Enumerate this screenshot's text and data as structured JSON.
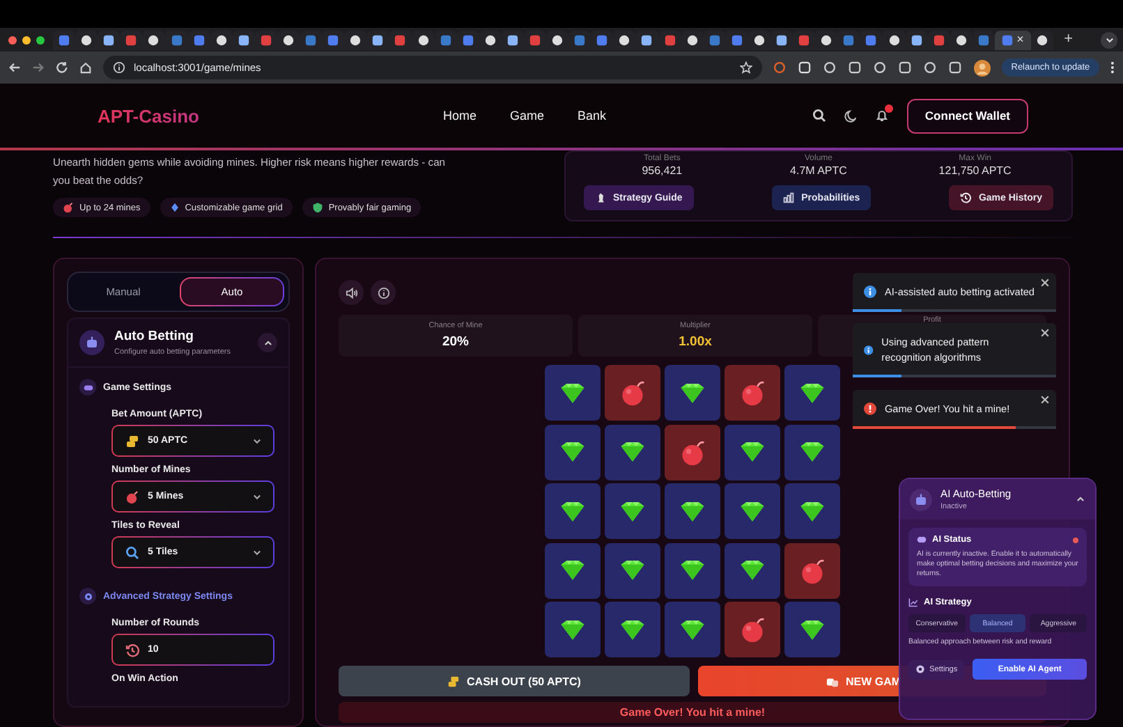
{
  "browser": {
    "tabs": [
      {
        "selected": false
      },
      {
        "selected": false
      },
      {
        "selected": false
      },
      {
        "selected": false
      },
      {
        "selected": false
      },
      {
        "selected": false
      },
      {
        "selected": false
      },
      {
        "selected": false
      },
      {
        "selected": false
      },
      {
        "selected": false
      },
      {
        "selected": false
      },
      {
        "selected": false
      },
      {
        "selected": false
      },
      {
        "selected": false
      },
      {
        "selected": false
      },
      {
        "selected": false
      },
      {
        "selected": false
      },
      {
        "selected": false
      },
      {
        "selected": false
      },
      {
        "selected": false
      },
      {
        "selected": false
      },
      {
        "selected": false
      },
      {
        "selected": false
      },
      {
        "selected": false
      },
      {
        "selected": false
      },
      {
        "selected": false
      },
      {
        "selected": false
      },
      {
        "selected": false
      },
      {
        "selected": false
      },
      {
        "selected": false
      },
      {
        "selected": false
      },
      {
        "selected": false
      },
      {
        "selected": false
      },
      {
        "selected": false
      },
      {
        "selected": false
      },
      {
        "selected": false
      },
      {
        "selected": false
      },
      {
        "selected": false
      },
      {
        "selected": false
      },
      {
        "selected": false
      },
      {
        "selected": false
      },
      {
        "selected": false
      },
      {
        "selected": true,
        "close": "×"
      },
      {
        "selected": false
      }
    ],
    "new_tab": "+",
    "url": "localhost:3001/game/mines",
    "update_button": "Relaunch to update"
  },
  "header": {
    "logo": "APT-Casino",
    "nav": [
      "Home",
      "Game",
      "Bank"
    ],
    "connect_button": "Connect Wallet"
  },
  "hero": {
    "description": "Unearth hidden gems while avoiding mines. Higher risk means higher rewards - can you beat the odds?",
    "features": [
      {
        "kind": "mine",
        "label": "Up to 24 mines"
      },
      {
        "kind": "grid",
        "label": "Customizable game grid"
      },
      {
        "kind": "fair",
        "label": "Provably fair gaming"
      }
    ]
  },
  "stats": [
    {
      "label": "Total Bets",
      "value": "956,421"
    },
    {
      "label": "Volume",
      "value": "4.7M APTC"
    },
    {
      "label": "Max Win",
      "value": "121,750 APTC"
    }
  ],
  "action_buttons": [
    {
      "kind": "guide",
      "label": "Strategy Guide",
      "color": "#35184f"
    },
    {
      "kind": "chart",
      "label": "Probabilities",
      "color": "#1d2350"
    },
    {
      "kind": "history",
      "label": "Game History",
      "color": "#461427"
    }
  ],
  "mode_toggle": [
    {
      "label": "Manual",
      "selected": false
    },
    {
      "label": "Auto",
      "selected": true
    }
  ],
  "auto_betting": {
    "title": "Auto Betting",
    "subtitle": "Configure auto betting parameters",
    "expanded": true,
    "sections": [
      {
        "kind": "game",
        "title": "Game Settings",
        "fields": [
          {
            "label": "Bet Amount (APTC)",
            "kind": "select",
            "value": "50 APTC"
          },
          {
            "label": "Number of Mines",
            "kind": "select",
            "value": "5 Mines"
          },
          {
            "label": "Tiles to Reveal",
            "kind": "select",
            "value": "5 Tiles"
          }
        ]
      },
      {
        "kind": "advanced",
        "title": "Advanced Strategy Settings",
        "fields": [
          {
            "label": "Number of Rounds",
            "kind": "input",
            "value": "10"
          },
          {
            "label": "On Win Action"
          }
        ]
      }
    ]
  },
  "game": {
    "stats": [
      {
        "label": "Chance of Mine",
        "value": "20%",
        "kind": "plain"
      },
      {
        "label": "Multiplier",
        "value": "1.00x",
        "kind": "highlight"
      },
      {
        "label": "Profit"
      }
    ],
    "tiles": [
      {
        "kind": "gem"
      },
      {
        "kind": "mine"
      },
      {
        "kind": "gem"
      },
      {
        "kind": "mine"
      },
      {
        "kind": "gem"
      },
      {
        "kind": "gem"
      },
      {
        "kind": "gem"
      },
      {
        "kind": "mine"
      },
      {
        "kind": "gem"
      },
      {
        "kind": "gem"
      },
      {
        "kind": "gem"
      },
      {
        "kind": "gem"
      },
      {
        "kind": "gem"
      },
      {
        "kind": "gem"
      },
      {
        "kind": "gem"
      },
      {
        "kind": "gem"
      },
      {
        "kind": "gem"
      },
      {
        "kind": "gem"
      },
      {
        "kind": "gem"
      },
      {
        "kind": "mine"
      },
      {
        "kind": "gem"
      },
      {
        "kind": "gem"
      },
      {
        "kind": "gem"
      },
      {
        "kind": "mine"
      },
      {
        "kind": "gem"
      }
    ],
    "cash_out": "CASH OUT (50 APTC)",
    "new_game": "NEW GAM",
    "result": "Game Over! You hit a mine!"
  },
  "toasts": [
    {
      "kind": "info",
      "message": "AI-assisted auto betting activated",
      "level": 0.24
    },
    {
      "kind": "info",
      "message": "Using advanced pattern recognition algorithms",
      "level": 0.24
    },
    {
      "kind": "error",
      "message": "Game Over! You hit a mine!",
      "level": 0.8
    }
  ],
  "ai_panel": {
    "title": "AI Auto-Betting",
    "status": "Inactive",
    "expanded": true,
    "status_title": "AI Status",
    "active": false,
    "status_text": "AI is currently inactive. Enable it to automatically make optimal betting decisions and maximize your returns.",
    "strategy_title": "AI Strategy",
    "strategies": [
      {
        "label": "Conservative",
        "selected": false
      },
      {
        "label": "Balanced",
        "selected": true
      },
      {
        "label": "Aggressive",
        "selected": false
      }
    ],
    "strategy_description": "Balanced approach between risk and reward",
    "settings_button": "Settings",
    "enable_button": "Enable AI Agent"
  }
}
